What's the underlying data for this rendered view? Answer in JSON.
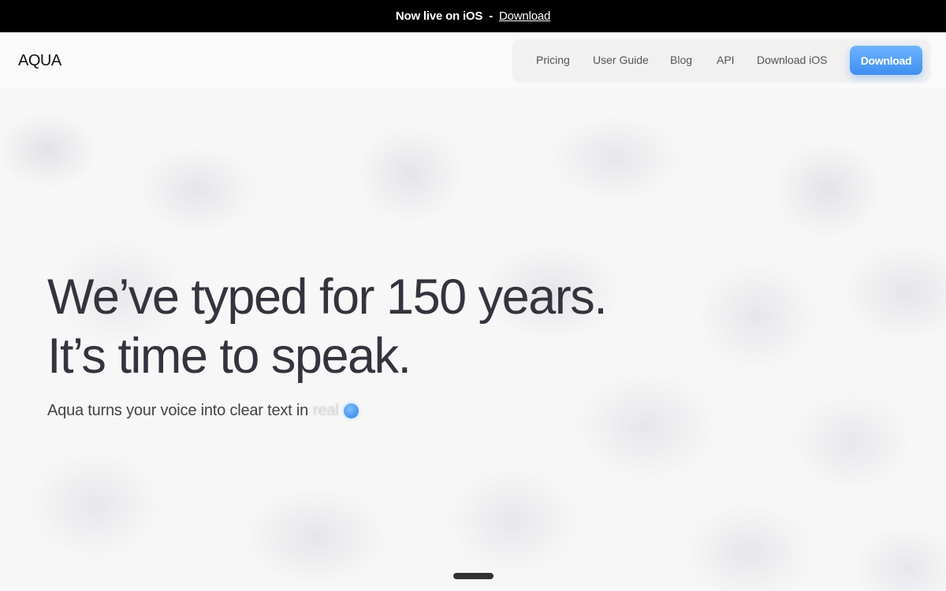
{
  "announcement": {
    "text": "Now live on iOS",
    "separator": "-",
    "link": "Download"
  },
  "header": {
    "logo": "AQUA",
    "nav": [
      {
        "label": "Pricing"
      },
      {
        "label": "User Guide"
      },
      {
        "label": "Blog"
      },
      {
        "label": "API"
      },
      {
        "label": "Download iOS"
      }
    ],
    "cta": "Download"
  },
  "hero": {
    "headline_line1": "We’ve typed for 150 years.",
    "headline_line2": "It’s time to speak.",
    "subline": "Aqua turns your voice into clear text in",
    "subline_fading": "real"
  },
  "colors": {
    "accent": "#4a9af5",
    "announcement_bg": "#000000",
    "headline": "#33343d"
  },
  "icons": {
    "recording_indicator": "blue-dot-icon"
  }
}
